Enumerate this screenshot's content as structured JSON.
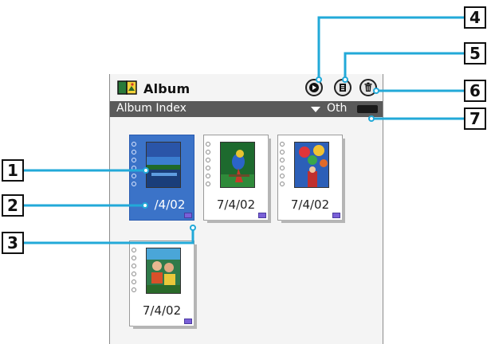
{
  "titlebar": {
    "app_title": "Album",
    "app_icon": "album-book-icon",
    "buttons": [
      {
        "name": "slideshow-button",
        "icon": "play-circle-icon"
      },
      {
        "name": "copy-button",
        "icon": "document-copy-icon"
      },
      {
        "name": "delete-button",
        "icon": "trash-icon"
      }
    ]
  },
  "indexbar": {
    "label": "Album Index",
    "category": "Oth",
    "category_arrow_icon": "triangle-down-icon"
  },
  "albums": [
    {
      "date": "7/4/02",
      "selected": true,
      "date_visible": "/4/02"
    },
    {
      "date": "7/4/02",
      "selected": false
    },
    {
      "date": "7/4/02",
      "selected": false
    },
    {
      "date": "7/4/02",
      "selected": false
    }
  ],
  "callouts": [
    "1",
    "2",
    "3",
    "4",
    "5",
    "6",
    "7"
  ],
  "colors": {
    "selection": "#3b73c8",
    "index_bar": "#5a5a5a",
    "callout_line": "#22a9d8",
    "mark": "#7a60d8"
  }
}
